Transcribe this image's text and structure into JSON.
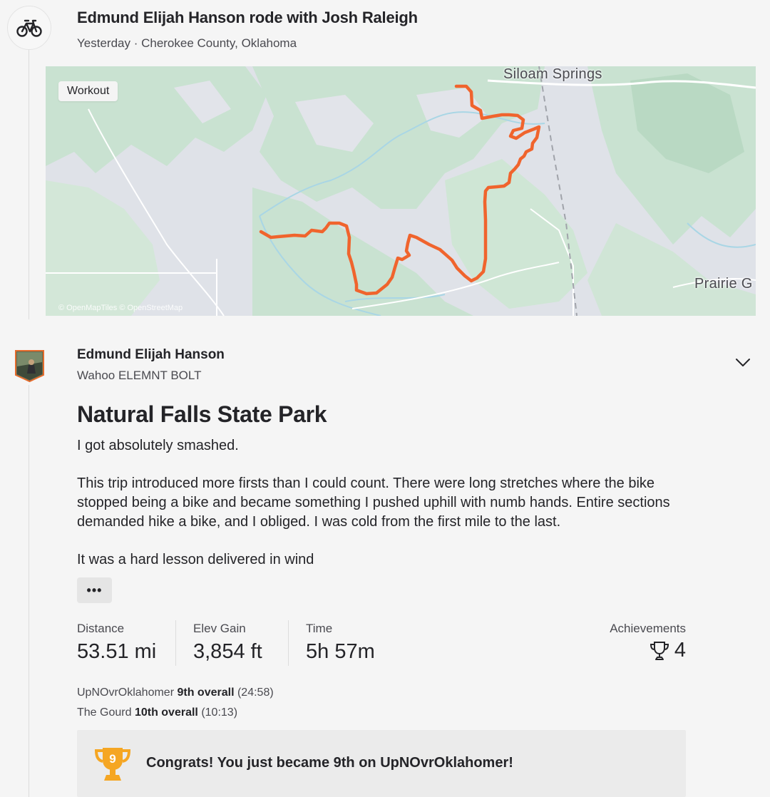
{
  "group": {
    "title": "Edmund Elijah Hanson rode with Josh Raleigh",
    "meta": "Yesterday · Cherokee County, Oklahoma"
  },
  "map": {
    "badge": "Workout",
    "label_top": "Siloam Springs",
    "label_right": "Prairie G",
    "attribution": "© OpenMapTiles © OpenStreetMap",
    "route_color": "#f0642d"
  },
  "athlete": {
    "name": "Edmund Elijah Hanson",
    "device": "Wahoo ELEMNT BOLT"
  },
  "activity": {
    "title": "Natural Falls State Park",
    "description": [
      "I got absolutely smashed.",
      "This trip introduced more firsts than I could count. There were long stretches where the bike stopped being a bike and became something I pushed uphill with numb hands. Entire sections demanded hike a bike, and I obliged. I was cold from the first mile to the last.",
      "It was a hard lesson delivered in wind"
    ],
    "more_label": "•••"
  },
  "stats": {
    "distance": {
      "label": "Distance",
      "value": "53.51 mi"
    },
    "elev_gain": {
      "label": "Elev Gain",
      "value": "3,854 ft"
    },
    "time": {
      "label": "Time",
      "value": "5h 57m"
    },
    "achievements": {
      "label": "Achievements",
      "value": "4"
    }
  },
  "segments": [
    {
      "name": "UpNOvrOklahomer",
      "rank": "9th overall",
      "time": "(24:58)"
    },
    {
      "name": "The Gourd",
      "rank": "10th overall",
      "time": "(10:13)"
    }
  ],
  "congrats": {
    "badge_number": "9",
    "text": "Congrats! You just became 9th on UpNOvrOklahomer!"
  },
  "colors": {
    "accent": "#f0642d",
    "trophy_gold": "#f5a623"
  }
}
